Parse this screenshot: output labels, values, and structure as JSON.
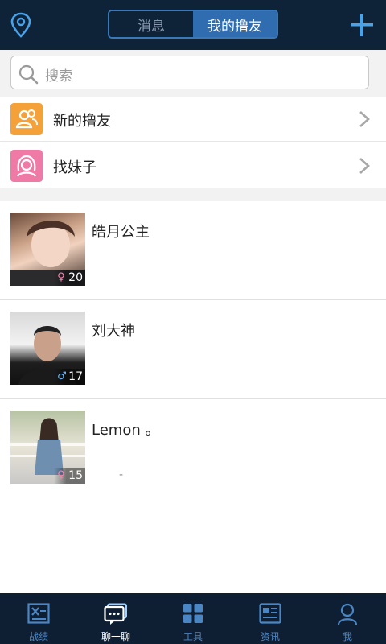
{
  "header": {
    "tabs": [
      {
        "label": "消息",
        "active": false
      },
      {
        "label": "我的撸友",
        "active": true
      }
    ],
    "left_icon": "location-pin-icon",
    "right_icon": "plus-icon"
  },
  "search": {
    "placeholder": "搜索"
  },
  "entries": [
    {
      "label": "新的撸友",
      "icon": "new-friends-icon",
      "color": "#f5a13a"
    },
    {
      "label": "找妹子",
      "icon": "find-girls-icon",
      "color": "#f07aa6"
    }
  ],
  "friends": [
    {
      "name": "皓月公主",
      "gender": "♀",
      "age": "20"
    },
    {
      "name": "刘大神",
      "gender": "♂",
      "age": "17"
    },
    {
      "name": "Lemon 。",
      "gender": "♀",
      "age": "15",
      "extra": "-"
    }
  ],
  "tabbar": [
    {
      "label": "战绩",
      "icon": "record-icon",
      "active": false
    },
    {
      "label": "聊一聊",
      "icon": "chat-icon",
      "active": true
    },
    {
      "label": "工具",
      "icon": "grid-icon",
      "active": false
    },
    {
      "label": "资讯",
      "icon": "news-icon",
      "active": false
    },
    {
      "label": "我",
      "icon": "person-icon",
      "active": false
    }
  ],
  "colors": {
    "header_bg": "#0e2238",
    "accent": "#2f6db0",
    "tabbar_bg": "#0f1f33"
  }
}
